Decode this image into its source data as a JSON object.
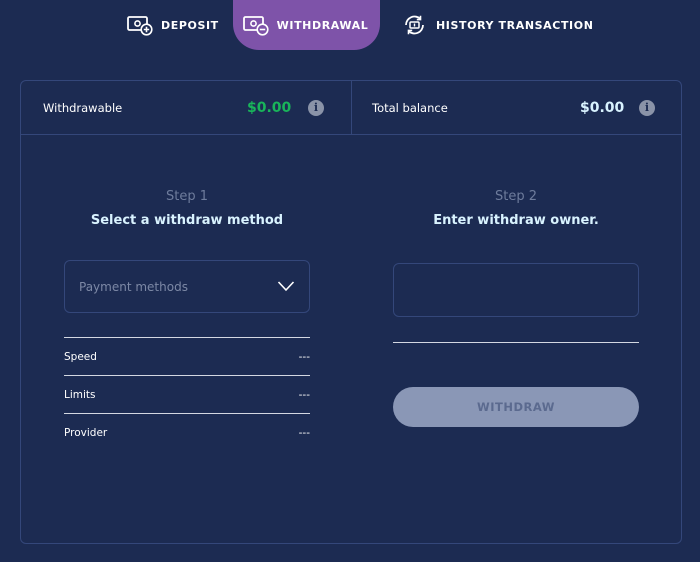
{
  "tabs": {
    "deposit": {
      "label": "DEPOSIT",
      "icon": "deposit-icon"
    },
    "withdrawal": {
      "label": "WITHDRAWAL",
      "icon": "withdrawal-icon",
      "active": true
    },
    "history": {
      "label": "HISTORY TRANSACTION",
      "icon": "history-icon"
    }
  },
  "balances": {
    "withdrawable": {
      "label": "Withdrawable",
      "amount": "$0.00",
      "color": "#19b45a"
    },
    "total": {
      "label": "Total balance",
      "amount": "$0.00",
      "color": "#d9f3ff"
    },
    "info_glyph": "i"
  },
  "step1": {
    "number": "Step 1",
    "title": "Select a withdraw method",
    "select_placeholder": "Payment methods",
    "rows": [
      {
        "label": "Speed",
        "value": "---"
      },
      {
        "label": "Limits",
        "value": "---"
      },
      {
        "label": "Provider",
        "value": "---"
      }
    ]
  },
  "step2": {
    "number": "Step 2",
    "title": "Enter withdraw owner.",
    "input_value": "",
    "button_label": "WITHDRAW"
  },
  "colors": {
    "background": "#1c2b52",
    "border": "#34477a",
    "active_tab": "#7e53a9",
    "button_disabled": "#8a97b6"
  }
}
